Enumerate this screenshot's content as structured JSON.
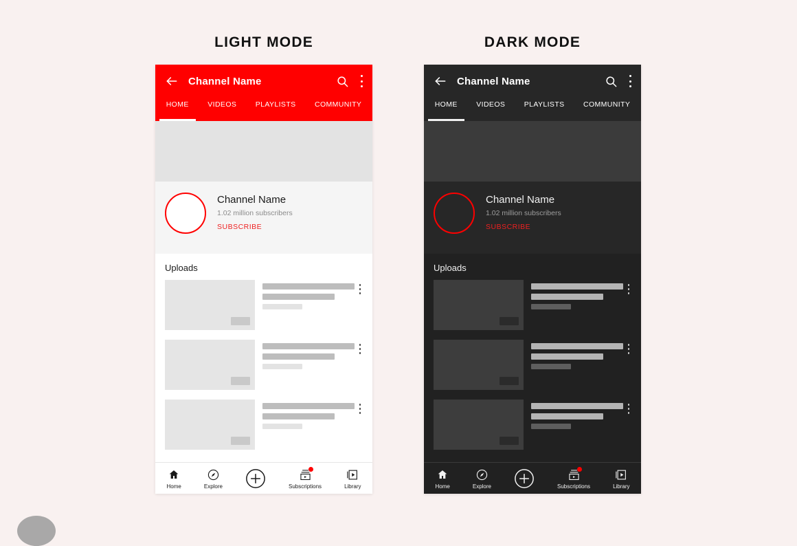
{
  "page": {
    "background_color": "#f9f1f0",
    "accent_red": "#ff0000"
  },
  "panels": [
    {
      "id": "light",
      "heading": "LIGHT MODE",
      "theme": {
        "appbar_bg": "#ff0000",
        "banner_bg": "#e3e3e3",
        "channel_bg": "#f5f5f5",
        "content_bg": "#ffffff",
        "thumb_bg": "#e5e5e5",
        "text_primary": "#1a1a1a",
        "text_secondary": "#8b8b8b"
      }
    },
    {
      "id": "dark",
      "heading": "DARK MODE",
      "theme": {
        "appbar_bg": "#272727",
        "banner_bg": "#3b3b3b",
        "channel_bg": "#272727",
        "content_bg": "#212121",
        "thumb_bg": "#3d3d3d",
        "text_primary": "#f1f1f1",
        "text_secondary": "#9e9e9e"
      }
    }
  ],
  "appbar": {
    "back_icon": "arrow-left-icon",
    "title": "Channel Name",
    "search_icon": "search-icon",
    "overflow_icon": "overflow-menu-icon"
  },
  "tabs": [
    {
      "label": "HOME",
      "active": true
    },
    {
      "label": "VIDEOS",
      "active": false
    },
    {
      "label": "PLAYLISTS",
      "active": false
    },
    {
      "label": "COMMUNITY",
      "active": false
    }
  ],
  "channel": {
    "avatar": "channel-avatar",
    "name": "Channel Name",
    "subscribers": "1.02 million subscribers",
    "subscribe_label": "SUBSCRIBE",
    "subscribe_color": "#ee2020"
  },
  "uploads": {
    "section_title": "Uploads",
    "items": [
      {
        "thumbnail": "video-thumbnail-placeholder",
        "duration_badge": "duration-placeholder",
        "title_bar": "title-line-placeholder",
        "subtitle_bar": "title-line-2-placeholder",
        "meta_bar": "meta-line-placeholder",
        "overflow_icon": "overflow-menu-icon"
      },
      {
        "thumbnail": "video-thumbnail-placeholder",
        "duration_badge": "duration-placeholder",
        "title_bar": "title-line-placeholder",
        "subtitle_bar": "title-line-2-placeholder",
        "meta_bar": "meta-line-placeholder",
        "overflow_icon": "overflow-menu-icon"
      },
      {
        "thumbnail": "video-thumbnail-placeholder",
        "duration_badge": "duration-placeholder",
        "title_bar": "title-line-placeholder",
        "subtitle_bar": "title-line-2-placeholder",
        "meta_bar": "meta-line-placeholder",
        "overflow_icon": "overflow-menu-icon"
      }
    ]
  },
  "bottom_nav": [
    {
      "label": "Home",
      "icon": "home-icon",
      "badge": false
    },
    {
      "label": "Explore",
      "icon": "compass-icon",
      "badge": false
    },
    {
      "label": "",
      "icon": "plus-circle-icon",
      "badge": false
    },
    {
      "label": "Subscriptions",
      "icon": "subscriptions-icon",
      "badge": true
    },
    {
      "label": "Library",
      "icon": "library-icon",
      "badge": false
    }
  ]
}
